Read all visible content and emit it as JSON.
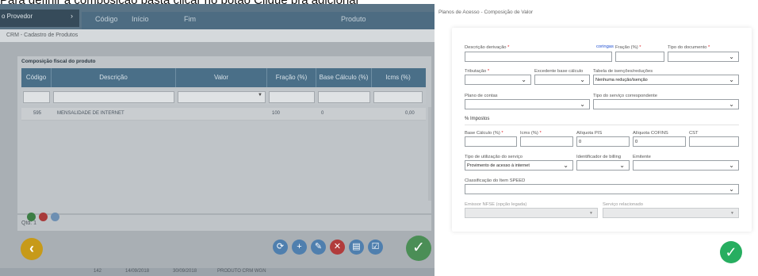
{
  "caption": "Para definir a composição basta clicar no botão  Clique pra adicionar",
  "background_app": {
    "provider_label": "o Provedor",
    "header_cells": [
      "Código",
      "Início",
      "Fim",
      "Produto"
    ],
    "crm_title": "CRM - Cadastro de Produtos",
    "card_title": "Composição fiscal do produto",
    "columns": [
      "Código",
      "Descrição",
      "Valor",
      "Fração (%)",
      "Base Cálculo (%)",
      "Icms (%)"
    ],
    "rows": [
      {
        "codigo": "595",
        "descricao": "MENSALIDADE DE INTERNET",
        "valor": "",
        "fracao": "100",
        "base": "0",
        "icms": "0,00"
      }
    ],
    "qtd_label": "Qtd: 1",
    "bottom_strip": [
      "142",
      "14/09/2018",
      "30/09/2018",
      "PRODUTO CRM WGN"
    ],
    "colors": {
      "back_button": "#c79a19",
      "confirm_button": "#4b8e56",
      "header": "#4a6f88"
    }
  },
  "modal": {
    "title": "Planos de Acesso - Composição de Valor",
    "fields": {
      "descricao_derivacao": {
        "label": "Descrição derivação",
        "value": ""
      },
      "coringas": "coringas",
      "fracao": {
        "label": "Fração (%)",
        "value": ""
      },
      "tipo_documento": {
        "label": "Tipo do documento",
        "value": ""
      },
      "tributacao": {
        "label": "Tributação",
        "value": ""
      },
      "excedente_base_calculo": {
        "label": "Excedente base cálculo",
        "value": ""
      },
      "tabela_isencoes": {
        "label": "Tabela de isenções/reduções",
        "value": "Nenhuma redução/isenção"
      },
      "plano_contas": {
        "label": "Plano de contas",
        "value": ""
      },
      "tipo_servico_correspondente": {
        "label": "Tipo do serviço correspondente",
        "value": ""
      },
      "base_calculo": {
        "label": "Base Cálculo (%)",
        "value": ""
      },
      "icms": {
        "label": "Icms (%)",
        "value": ""
      },
      "aliquota_pis": {
        "label": "Alíquota PIS",
        "value": "0"
      },
      "aliquota_cofins": {
        "label": "Alíquota COFINS",
        "value": "0"
      },
      "cst": {
        "label": "CST",
        "value": ""
      },
      "tipo_utilizacao": {
        "label": "Tipo de utilização do serviço",
        "value": "Provimento de acesso à internet"
      },
      "identificador_billing": {
        "label": "Identificador de billing",
        "value": ""
      },
      "emitente": {
        "label": "Emitente",
        "value": ""
      },
      "classificacao_speed": {
        "label": "Classificação do Item SPEED",
        "value": ""
      },
      "emissor_nfse": {
        "label": "Emissor NFSE (opção legada)",
        "value": ""
      },
      "servico_relacionado": {
        "label": "Serviço relacionado",
        "value": ""
      }
    },
    "section_impostos": "% Impostos",
    "required_marker": "*",
    "colors": {
      "confirm": "#27ae60",
      "required": "#e0262b",
      "link": "#1f4fd1"
    }
  }
}
